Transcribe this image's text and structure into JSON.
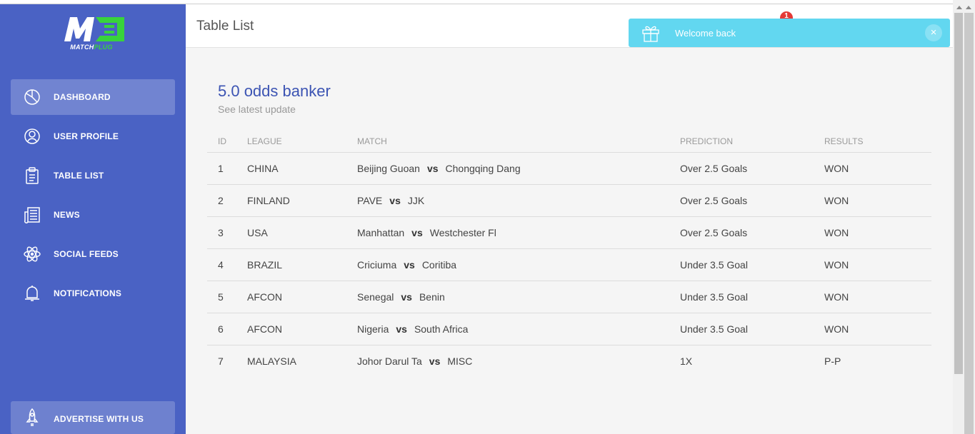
{
  "app": {
    "brand_prefix": "MATCH",
    "brand_suffix": "PLUG",
    "accent_color": "#4a62c4",
    "logo_green": "#38d33c"
  },
  "sidebar": {
    "items": [
      {
        "label": "DASHBOARD",
        "icon": "pie-chart-icon",
        "active": true
      },
      {
        "label": "USER PROFILE",
        "icon": "user-icon",
        "active": false
      },
      {
        "label": "TABLE LIST",
        "icon": "clipboard-icon",
        "active": false
      },
      {
        "label": "NEWS",
        "icon": "newspaper-icon",
        "active": false
      },
      {
        "label": "SOCIAL FEEDS",
        "icon": "atom-icon",
        "active": false
      },
      {
        "label": "NOTIFICATIONS",
        "icon": "bell-icon",
        "active": false
      }
    ],
    "advertise": {
      "label": "ADVERTISE WITH US",
      "icon": "rocket-icon"
    }
  },
  "header": {
    "title": "Table List",
    "notification_count": "1"
  },
  "toast": {
    "message": "Welcome back",
    "close_label": "×",
    "icon": "gift-icon"
  },
  "card": {
    "title": "5.0 odds banker",
    "subtitle": "See latest update",
    "vs_label": "vs",
    "columns": [
      "ID",
      "LEAGUE",
      "MATCH",
      "PREDICTION",
      "RESULTS"
    ],
    "rows": [
      {
        "id": "1",
        "league": "CHINA",
        "home": "Beijing Guoan",
        "away": "Chongqing Dang",
        "prediction": "Over 2.5 Goals",
        "result": "WON"
      },
      {
        "id": "2",
        "league": "FINLAND",
        "home": "PAVE",
        "away": "JJK",
        "prediction": "Over 2.5 Goals",
        "result": "WON"
      },
      {
        "id": "3",
        "league": "USA",
        "home": "Manhattan",
        "away": "Westchester Fl",
        "prediction": "Over 2.5 Goals",
        "result": "WON"
      },
      {
        "id": "4",
        "league": "BRAZIL",
        "home": "Criciuma",
        "away": "Coritiba",
        "prediction": "Under 3.5 Goal",
        "result": "WON"
      },
      {
        "id": "5",
        "league": "AFCON",
        "home": "Senegal",
        "away": "Benin",
        "prediction": "Under 3.5 Goal",
        "result": "WON"
      },
      {
        "id": "6",
        "league": "AFCON",
        "home": "Nigeria",
        "away": "South Africa",
        "prediction": "Under 3.5 Goal",
        "result": "WON"
      },
      {
        "id": "7",
        "league": "MALAYSIA",
        "home": "Johor Darul Ta",
        "away": "MISC",
        "prediction": "1X",
        "result": "P-P"
      }
    ]
  }
}
